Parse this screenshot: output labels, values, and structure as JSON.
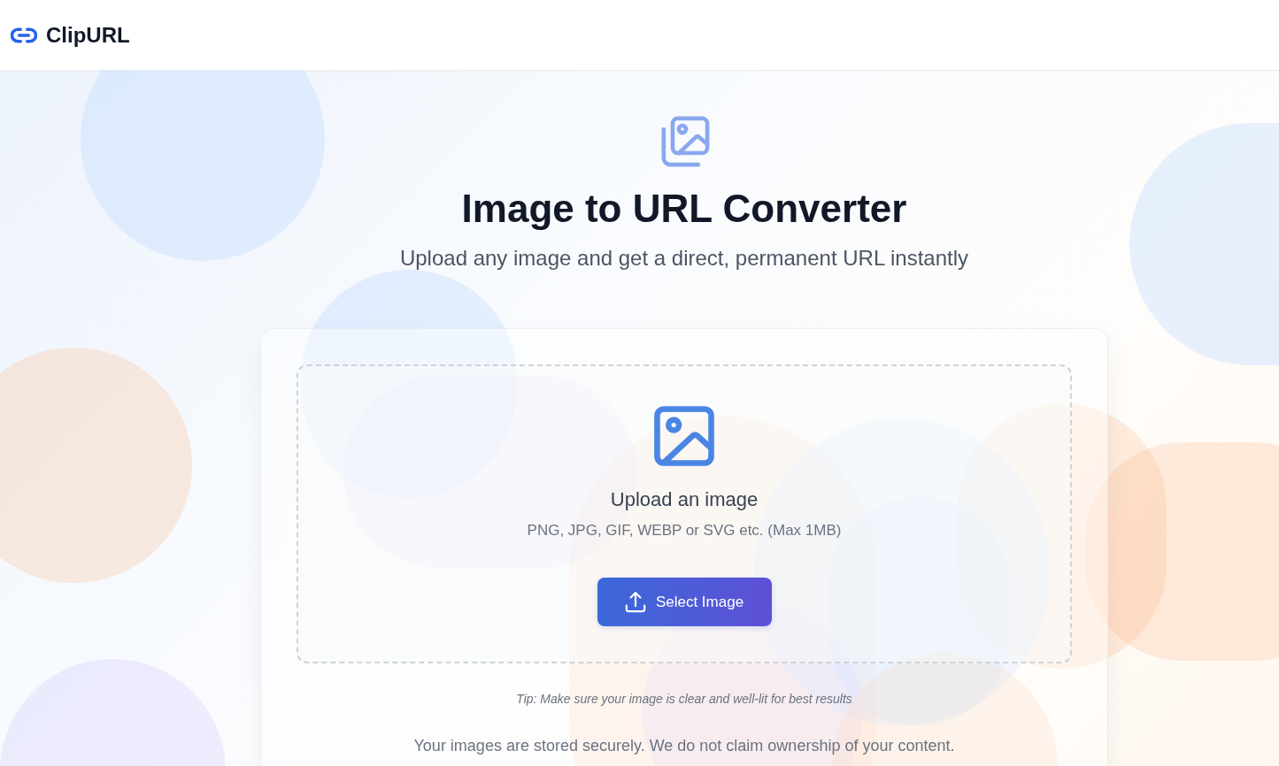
{
  "header": {
    "brand": "ClipURL"
  },
  "hero": {
    "title": "Image to URL Converter",
    "subtitle": "Upload any image and get a direct, permanent URL instantly"
  },
  "upload_card": {
    "dropzone": {
      "heading": "Upload an image",
      "hint": "PNG, JPG, GIF, WEBP or SVG etc. (Max 1MB)",
      "button": "Select Image"
    },
    "tip": "Tip: Make sure your image is clear and well-lit for best results",
    "notice": "Your images are stored securely. We do not claim ownership of your content."
  }
}
